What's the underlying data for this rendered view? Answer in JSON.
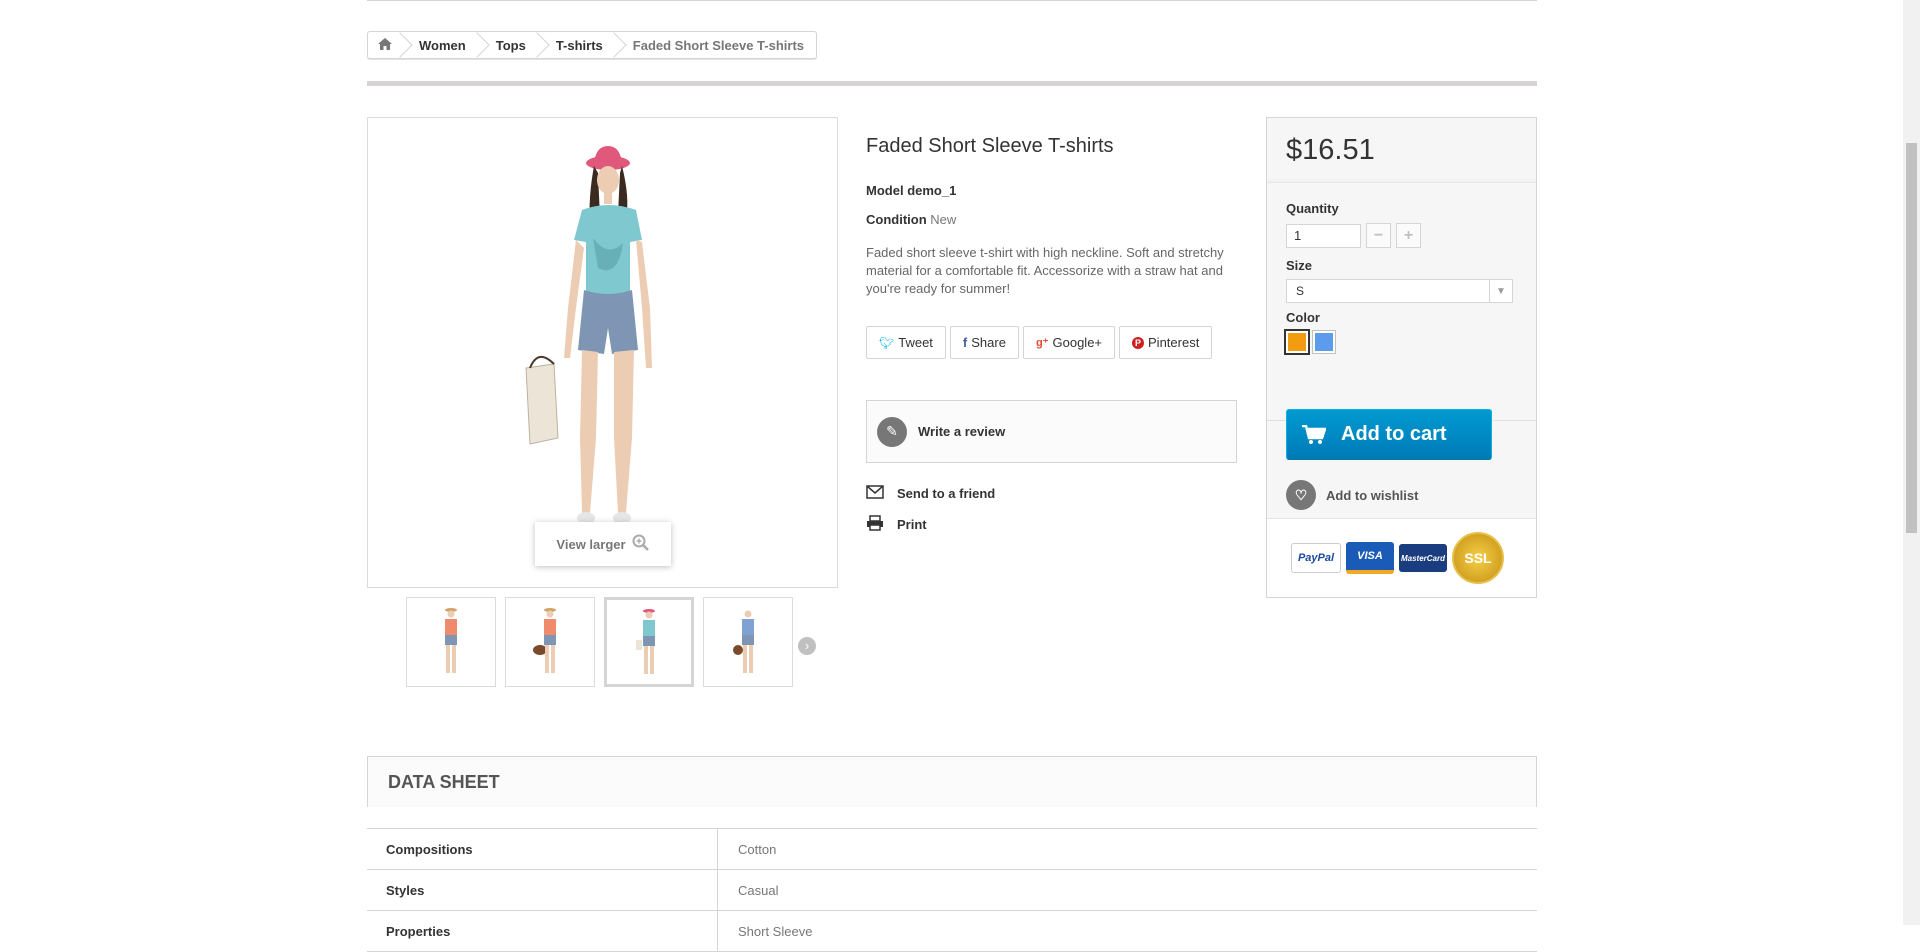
{
  "breadcrumb": {
    "items": [
      "Women",
      "Tops",
      "T-shirts"
    ],
    "current": "Faded Short Sleeve T-shirts"
  },
  "gallery": {
    "view_larger": "View larger",
    "thumb_count": 4,
    "active_thumb": 3
  },
  "product": {
    "name": "Faded Short Sleeve T-shirts",
    "model_label": "Model",
    "model": "demo_1",
    "condition_label": "Condition",
    "condition": "New",
    "description": "Faded short sleeve t-shirt with high neckline. Soft and stretchy material for a comfortable fit. Accessorize with a straw hat and you're ready for summer!"
  },
  "social": {
    "tweet": "Tweet",
    "share": "Share",
    "google": "Google+",
    "pinterest": "Pinterest"
  },
  "actions": {
    "write_review": "Write a review",
    "send_friend": "Send to a friend",
    "print": "Print"
  },
  "buy": {
    "price": "$16.51",
    "quantity_label": "Quantity",
    "quantity": "1",
    "size_label": "Size",
    "size": "S",
    "color_label": "Color",
    "colors": [
      "#f39c11",
      "#5d9cec"
    ],
    "add_to_cart": "Add to cart",
    "add_to_wishlist": "Add to wishlist",
    "payment": [
      "PayPal",
      "VISA",
      "MasterCard",
      "SSL"
    ]
  },
  "datasheet": {
    "title": "DATA SHEET",
    "rows": [
      {
        "key": "Compositions",
        "value": "Cotton"
      },
      {
        "key": "Styles",
        "value": "Casual"
      },
      {
        "key": "Properties",
        "value": "Short Sleeve"
      }
    ]
  }
}
